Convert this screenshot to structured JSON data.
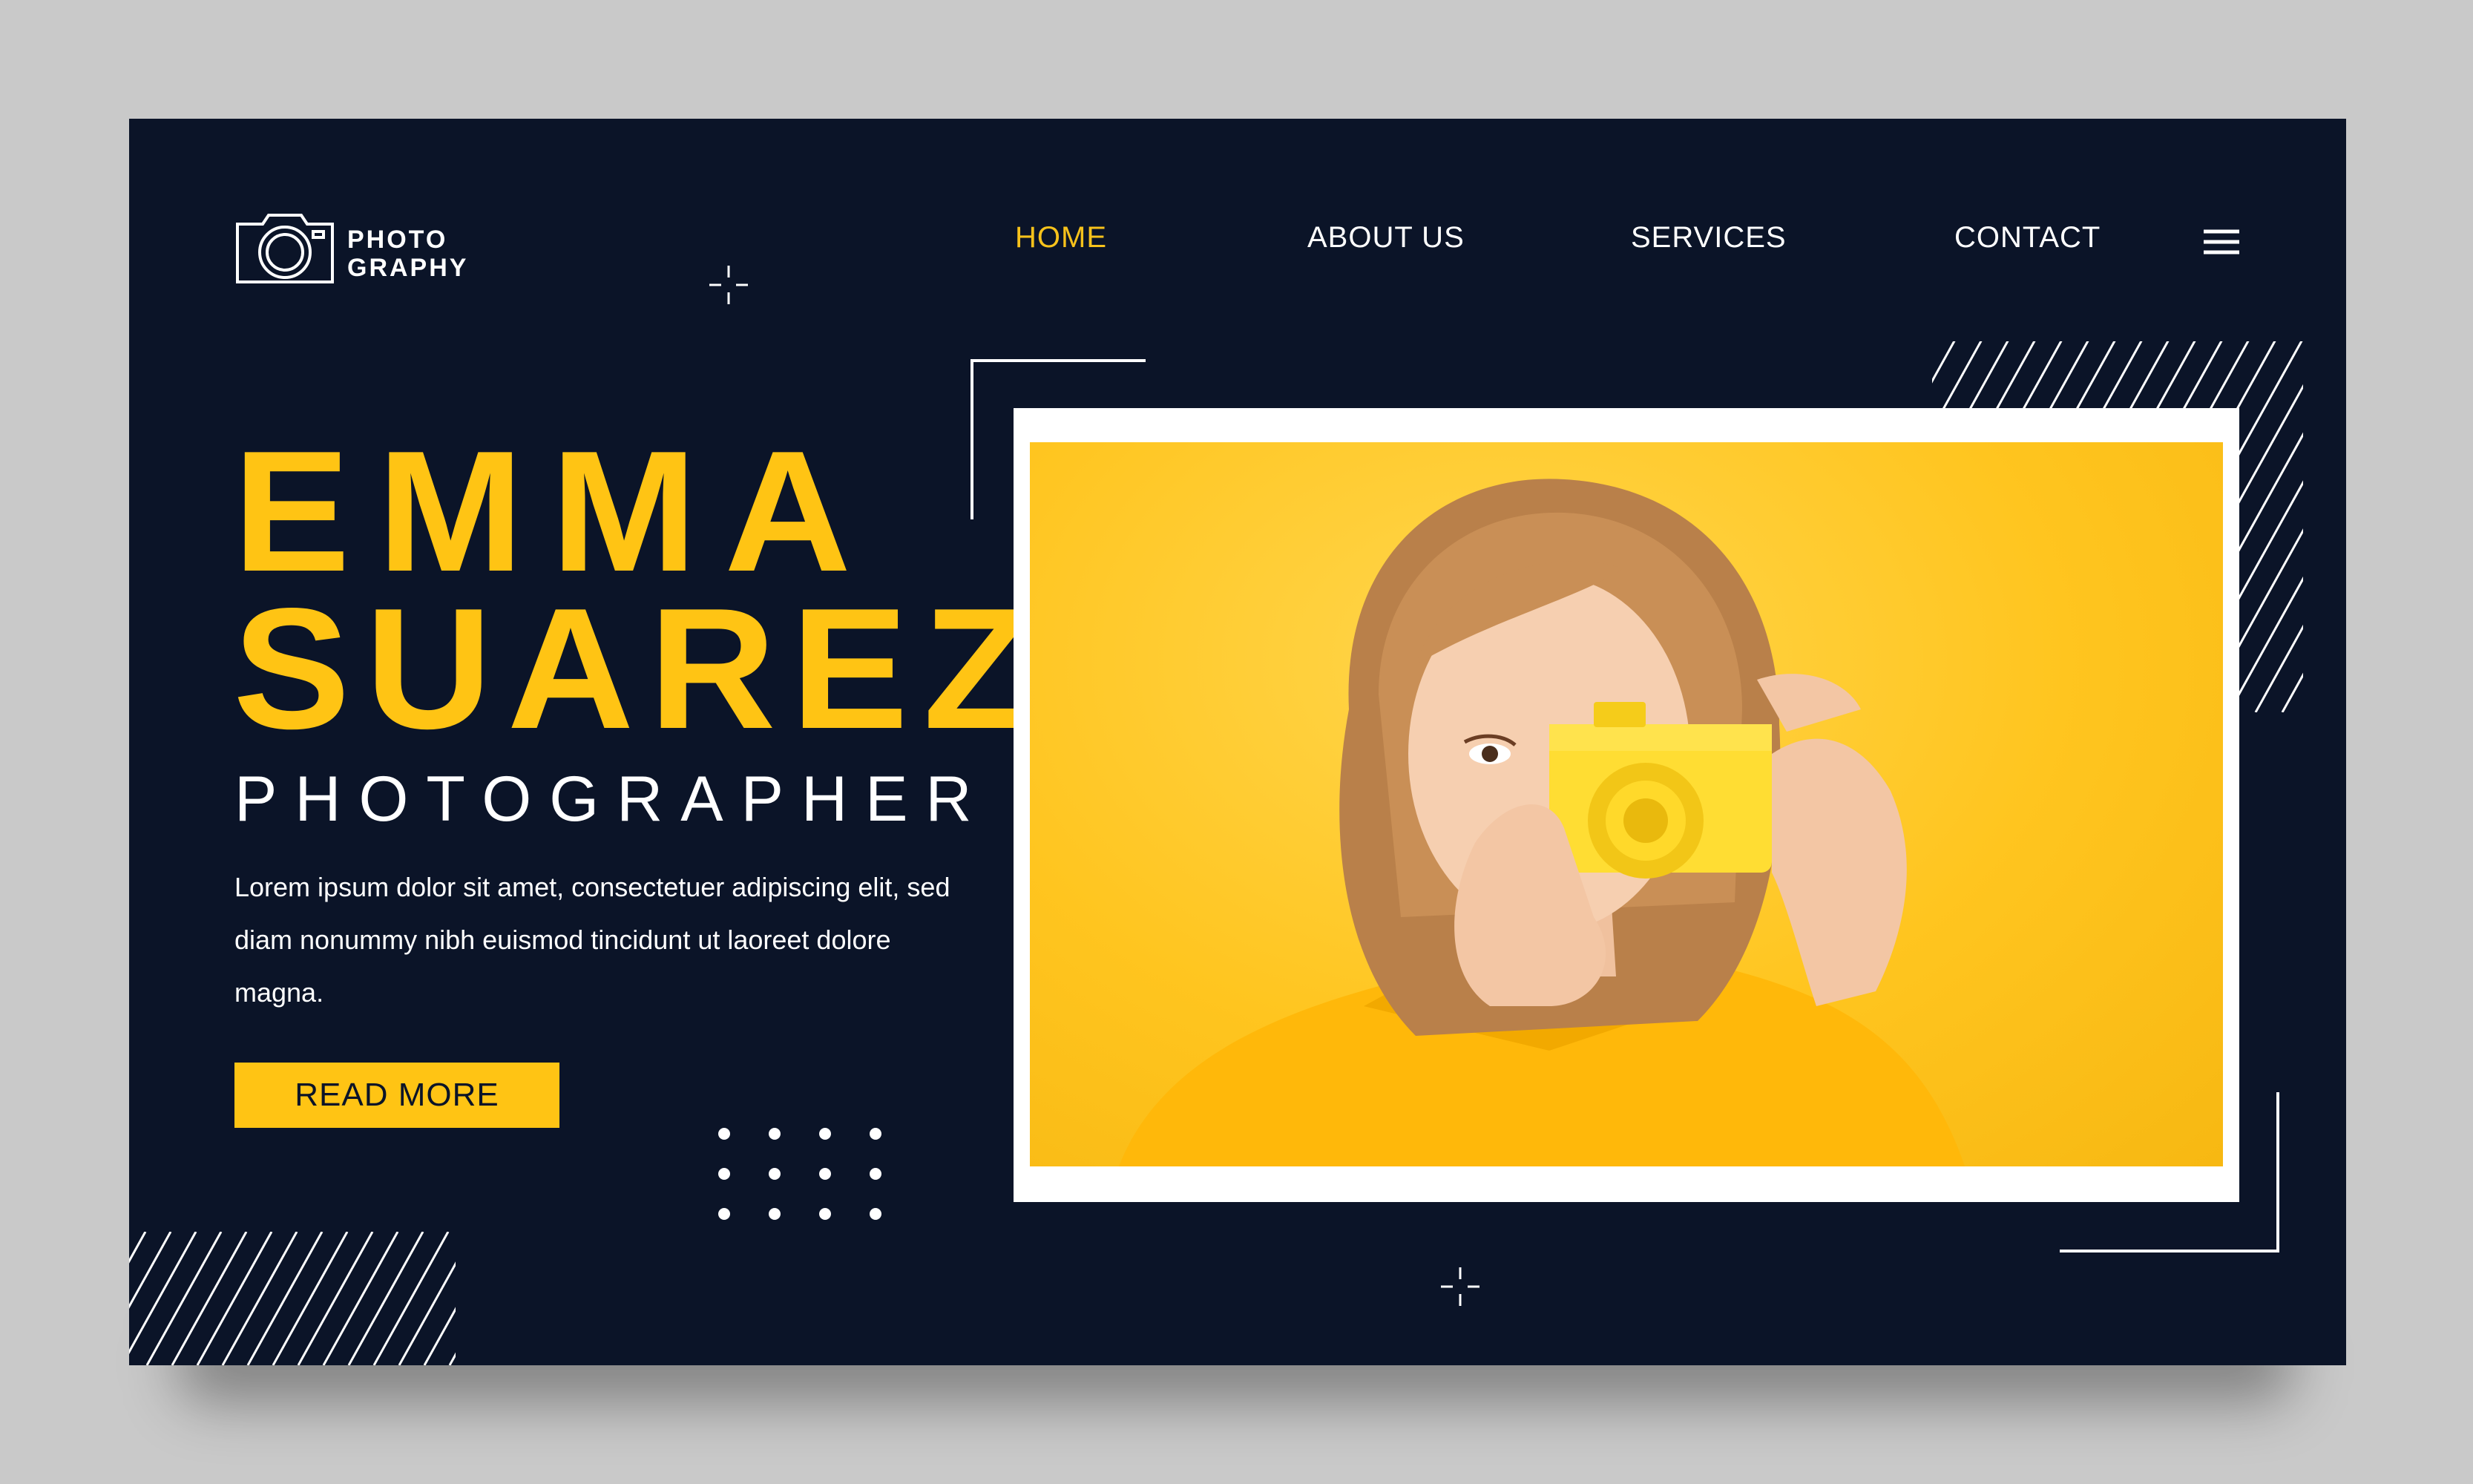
{
  "brand": {
    "logo_text": "PHOTO\nGRAPHY",
    "icon": "camera-icon"
  },
  "nav": {
    "items": [
      {
        "label": "HOME",
        "active": true
      },
      {
        "label": "ABOUT US",
        "active": false
      },
      {
        "label": "SERVICES",
        "active": false
      },
      {
        "label": "CONTACT",
        "active": false
      }
    ],
    "menu_icon": "hamburger-menu-icon"
  },
  "hero": {
    "first_name": "EMMA",
    "last_name": "SUAREZ",
    "role": "PHOTOGRAPHER",
    "description": "Lorem ipsum dolor sit amet, consectetuer adipiscing elit, sed diam nonummy nibh euismod tincidunt ut laoreet dolore magna.",
    "cta_label": "READ MORE"
  },
  "colors": {
    "background": "#0b1428",
    "accent": "#ffc414",
    "text": "#ffffff",
    "page_backdrop": "#c9c9c9"
  }
}
